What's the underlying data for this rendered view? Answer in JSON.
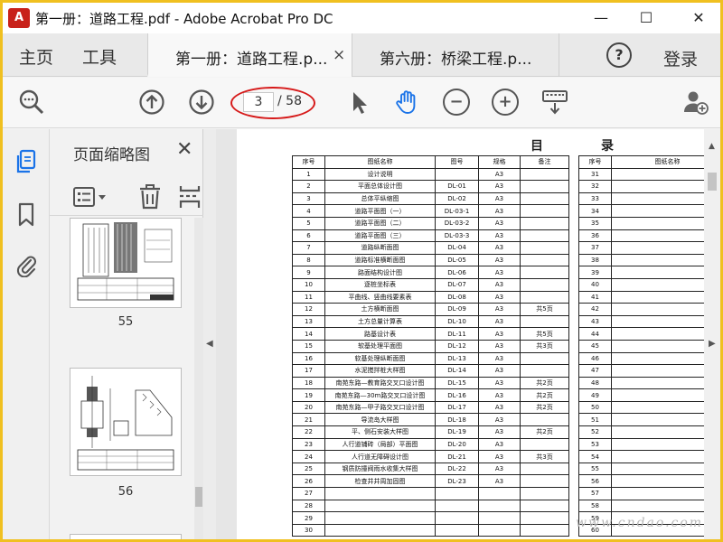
{
  "window": {
    "title": "第一册：道路工程.pdf - Adobe Acrobat Pro DC",
    "app_icon_glyph": "A",
    "controls": {
      "minimize": "—",
      "maximize": "☐",
      "close": "✕"
    }
  },
  "tabs": {
    "home": "主页",
    "tools": "工具",
    "documents": [
      {
        "label": "第一册：道路工程.p...",
        "active": true
      },
      {
        "label": "第六册：桥梁工程.p...",
        "active": false
      }
    ],
    "close_glyph": "×",
    "help": "?",
    "login": "登录"
  },
  "toolbar": {
    "current_page": "3",
    "total_pages": "/ 58",
    "zoom_out": "−",
    "zoom_in": "+"
  },
  "panel": {
    "title": "页面缩略图",
    "close": "✕",
    "thumbnails": [
      {
        "number": "55"
      },
      {
        "number": "56"
      }
    ]
  },
  "document": {
    "heading_left": "目",
    "heading_right": "录",
    "headers": [
      "序号",
      "图纸名称",
      "图号",
      "规格",
      "备注"
    ],
    "right_headers": [
      "序号",
      "图纸名称"
    ],
    "rows": [
      [
        "1",
        "设计说明",
        "",
        "A3",
        ""
      ],
      [
        "2",
        "平面总体设计图",
        "DL-01",
        "A3",
        ""
      ],
      [
        "3",
        "总体平纵缩图",
        "DL-02",
        "A3",
        ""
      ],
      [
        "4",
        "道路平面图（一）",
        "DL-03-1",
        "A3",
        ""
      ],
      [
        "5",
        "道路平面图（二）",
        "DL-03-2",
        "A3",
        ""
      ],
      [
        "6",
        "道路平面图（三）",
        "DL-03-3",
        "A3",
        ""
      ],
      [
        "7",
        "道路纵断面图",
        "DL-04",
        "A3",
        ""
      ],
      [
        "8",
        "道路标准横断面图",
        "DL-05",
        "A3",
        ""
      ],
      [
        "9",
        "路面结构设计图",
        "DL-06",
        "A3",
        ""
      ],
      [
        "10",
        "逐桩坐标表",
        "DL-07",
        "A3",
        ""
      ],
      [
        "11",
        "平曲线、竖曲线要素表",
        "DL-08",
        "A3",
        ""
      ],
      [
        "12",
        "土方横断面图",
        "DL-09",
        "A3",
        "共5页"
      ],
      [
        "13",
        "土方总量计算表",
        "DL-10",
        "A3",
        ""
      ],
      [
        "14",
        "路基设计表",
        "DL-11",
        "A3",
        "共5页"
      ],
      [
        "15",
        "软基处理平面图",
        "DL-12",
        "A3",
        "共3页"
      ],
      [
        "16",
        "软基处理纵断面图",
        "DL-13",
        "A3",
        ""
      ],
      [
        "17",
        "水泥搅拌桩大样图",
        "DL-14",
        "A3",
        ""
      ],
      [
        "18",
        "南苑东路—教育路交叉口设计图",
        "DL-15",
        "A3",
        "共2页"
      ],
      [
        "19",
        "南苑东路—30m路交叉口设计图",
        "DL-16",
        "A3",
        "共2页"
      ],
      [
        "20",
        "南苑东路—甲子路交叉口设计图",
        "DL-17",
        "A3",
        "共2页"
      ],
      [
        "21",
        "导流岛大样图",
        "DL-18",
        "A3",
        ""
      ],
      [
        "22",
        "平、侧石安装大样图",
        "DL-19",
        "A3",
        "共2页"
      ],
      [
        "23",
        "人行道铺砖（局部）平面图",
        "DL-20",
        "A3",
        ""
      ],
      [
        "24",
        "人行道无障碍设计图",
        "DL-21",
        "A3",
        "共3页"
      ],
      [
        "25",
        "钢质防撞阀雨水收集大样图",
        "DL-22",
        "A3",
        ""
      ],
      [
        "26",
        "检查井井周加固图",
        "DL-23",
        "A3",
        ""
      ],
      [
        "27",
        "",
        "",
        "",
        ""
      ],
      [
        "28",
        "",
        "",
        "",
        ""
      ],
      [
        "29",
        "",
        "",
        "",
        ""
      ],
      [
        "30",
        "",
        "",
        "",
        ""
      ]
    ],
    "right_numbers": [
      "31",
      "32",
      "33",
      "34",
      "35",
      "36",
      "37",
      "38",
      "39",
      "40",
      "41",
      "42",
      "43",
      "44",
      "45",
      "46",
      "47",
      "48",
      "49",
      "50",
      "51",
      "52",
      "53",
      "54",
      "55",
      "56",
      "57",
      "58",
      "59",
      "60"
    ]
  },
  "watermark": "www.cndao.com",
  "colors": {
    "frame": "#f0c020",
    "annotation": "#d61a1a",
    "accent": "#1a73e8"
  }
}
